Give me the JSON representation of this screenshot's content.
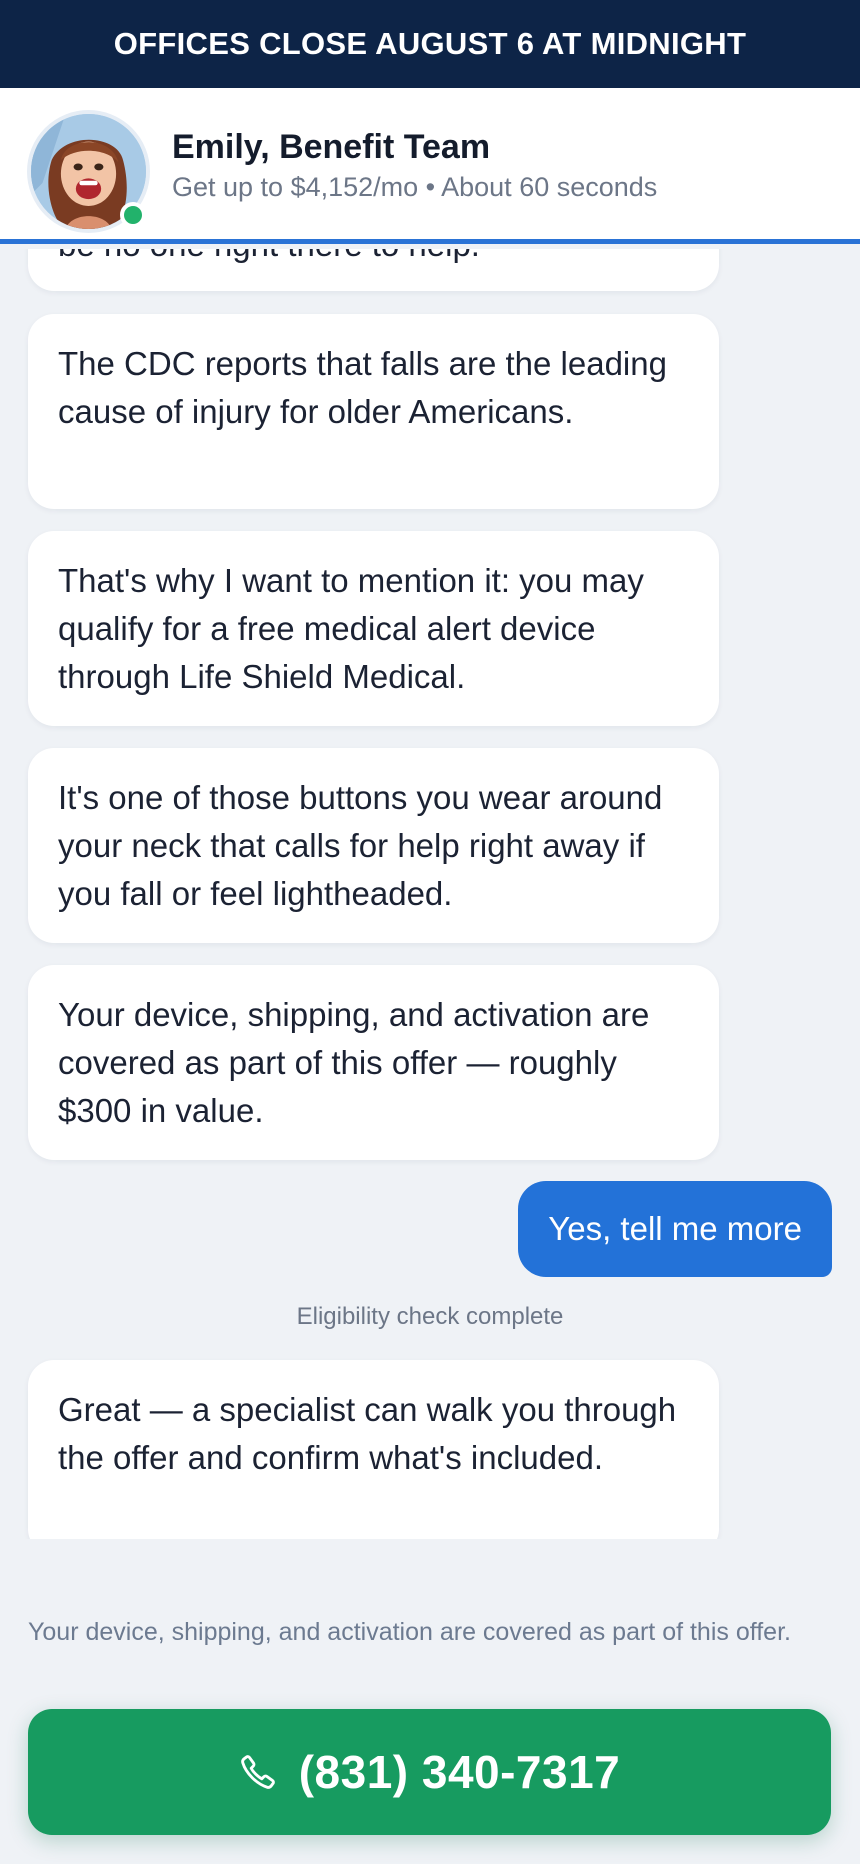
{
  "banner": {
    "text": "OFFICES CLOSE AUGUST 6 AT MIDNIGHT"
  },
  "header": {
    "agent_name": "Emily, Benefit Team",
    "subtitle": "Get up to $4,152/mo • About 60 seconds",
    "online_status_color": "#22b26b"
  },
  "chat": {
    "partial_message": "be no one right there to help.",
    "messages": [
      "The CDC reports that falls are the leading cause of injury for older Americans.",
      "That's why I want to mention it: you may qualify for a free medical alert device through Life Shield Medical.",
      "It's one of those buttons you wear around your neck that calls for help right away if you fall or feel lightheaded.",
      "Your device, shipping, and activation are covered as part of this offer — roughly $300 in value."
    ],
    "user_reply": "Yes, tell me more",
    "status": "Eligibility check complete",
    "final_message": "Great — a specialist can walk you through the offer and confirm what's included."
  },
  "disclaimer": "Your device, shipping, and activation are covered as part of this offer.",
  "cta": {
    "phone_number": "(831) 340-7317",
    "icon": "phone-icon"
  },
  "colors": {
    "banner_bg": "#0d2447",
    "accent_blue": "#2372d8",
    "cta_green": "#179b60",
    "page_bg": "#eff2f6"
  }
}
